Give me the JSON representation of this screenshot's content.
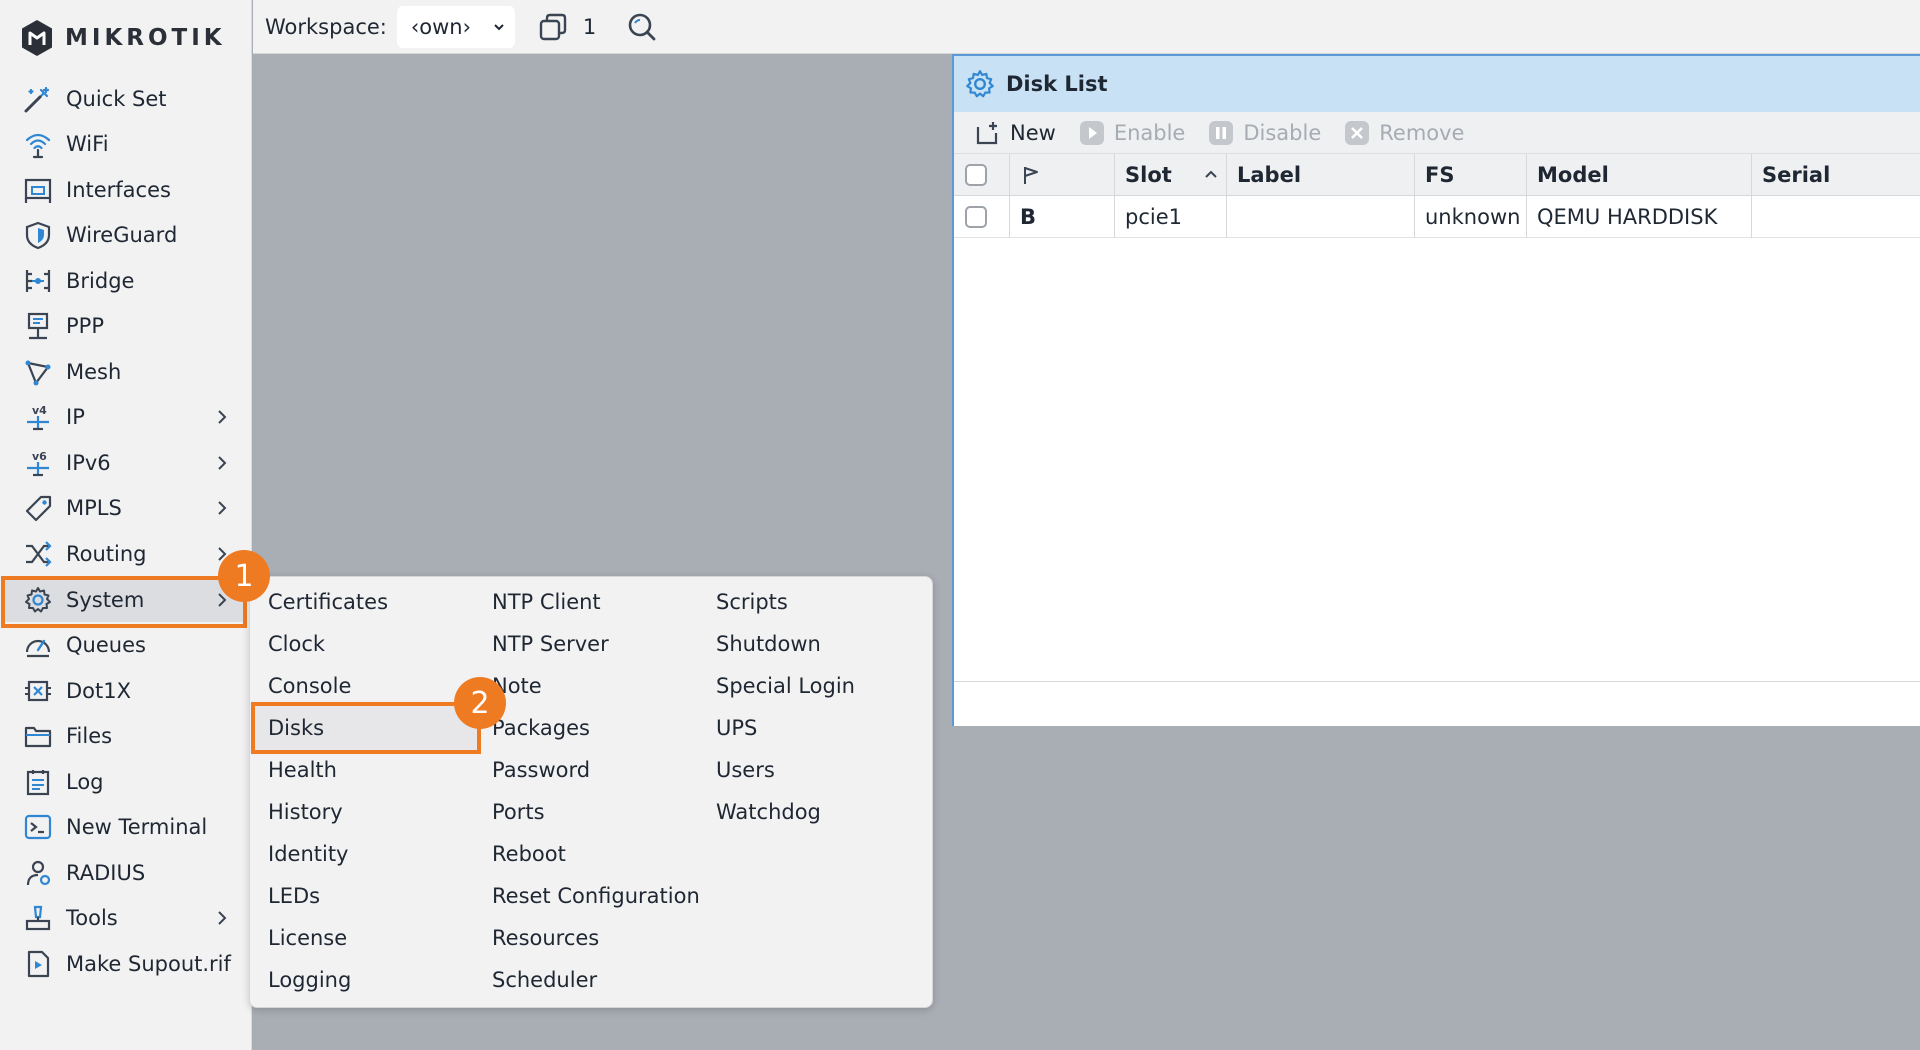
{
  "brand": {
    "name": "MikroTik",
    "logo_text": "mikrotik"
  },
  "sidebar": {
    "items": [
      {
        "label": "Quick Set",
        "icon": "wand-icon",
        "has_submenu": false
      },
      {
        "label": "WiFi",
        "icon": "wifi-icon",
        "has_submenu": false
      },
      {
        "label": "Interfaces",
        "icon": "interfaces-icon",
        "has_submenu": false
      },
      {
        "label": "WireGuard",
        "icon": "wireguard-shield-icon",
        "has_submenu": false
      },
      {
        "label": "Bridge",
        "icon": "bridge-icon",
        "has_submenu": false
      },
      {
        "label": "PPP",
        "icon": "ppp-icon",
        "has_submenu": false
      },
      {
        "label": "Mesh",
        "icon": "mesh-icon",
        "has_submenu": false
      },
      {
        "label": "IP",
        "icon": "ipv4-icon",
        "has_submenu": true
      },
      {
        "label": "IPv6",
        "icon": "ipv6-icon",
        "has_submenu": true
      },
      {
        "label": "MPLS",
        "icon": "tag-icon",
        "has_submenu": true
      },
      {
        "label": "Routing",
        "icon": "routing-icon",
        "has_submenu": true
      },
      {
        "label": "System",
        "icon": "gear-icon",
        "has_submenu": true,
        "active": true
      },
      {
        "label": "Queues",
        "icon": "gauge-icon",
        "has_submenu": false
      },
      {
        "label": "Dot1X",
        "icon": "dot1x-icon",
        "has_submenu": false
      },
      {
        "label": "Files",
        "icon": "folder-icon",
        "has_submenu": false
      },
      {
        "label": "Log",
        "icon": "log-icon",
        "has_submenu": false
      },
      {
        "label": "New Terminal",
        "icon": "terminal-icon",
        "has_submenu": false
      },
      {
        "label": "RADIUS",
        "icon": "radius-icon",
        "has_submenu": false
      },
      {
        "label": "Tools",
        "icon": "tools-icon",
        "has_submenu": true
      },
      {
        "label": "Make Supout.rif",
        "icon": "supout-icon",
        "has_submenu": false
      }
    ]
  },
  "topbar": {
    "workspace_label": "Workspace:",
    "workspace_value": "‹own›",
    "window_count": "1"
  },
  "window": {
    "title": "Disk List",
    "toolbar": {
      "new": "New",
      "enable": "Enable",
      "disable": "Disable",
      "remove": "Remove"
    },
    "columns": [
      "Slot",
      "Label",
      "FS",
      "Model",
      "Serial"
    ],
    "rows": [
      {
        "flag": "B",
        "slot": "pcie1",
        "label": "",
        "fs": "unknown",
        "model": "QEMU HARDDISK",
        "serial": ""
      }
    ]
  },
  "system_menu": {
    "col1": [
      "Certificates",
      "Clock",
      "Console",
      "Disks",
      "Health",
      "History",
      "Identity",
      "LEDs",
      "License",
      "Logging"
    ],
    "col2": [
      "NTP Client",
      "NTP Server",
      "Note",
      "Packages",
      "Password",
      "Ports",
      "Reboot",
      "Reset Configuration",
      "Resources",
      "Scheduler"
    ],
    "col3": [
      "Scripts",
      "Shutdown",
      "Special Login",
      "UPS",
      "Users",
      "Watchdog"
    ]
  },
  "annotations": {
    "step1": "1",
    "step2": "2"
  },
  "colors": {
    "accent_orange": "#ee7a22",
    "icon_blue": "#2f86d2",
    "title_bar": "#c9e1f4"
  }
}
